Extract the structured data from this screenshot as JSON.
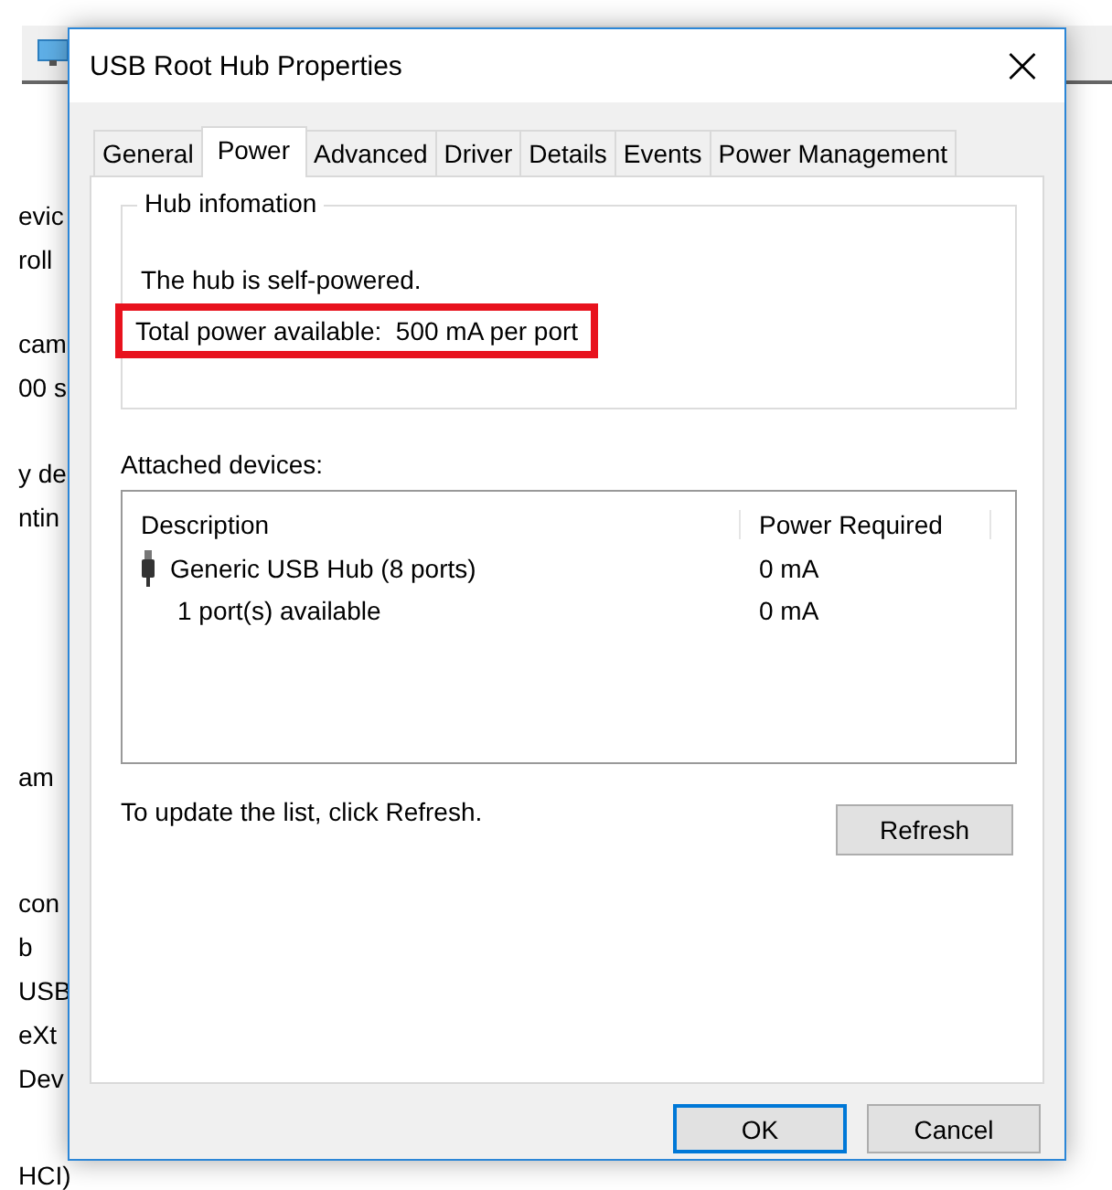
{
  "background_window": {
    "line_groups": [
      [
        "evic",
        "roll"
      ],
      [
        "cam",
        "00 s"
      ],
      [
        "y de",
        "ntin"
      ],
      [
        "am"
      ],
      [
        "con",
        "b",
        "USB",
        "eXt",
        "Dev"
      ],
      [
        "HCI)"
      ]
    ]
  },
  "dialog": {
    "title": "USB Root Hub Properties",
    "close": "×",
    "tabs": [
      {
        "label": "General",
        "selected": false
      },
      {
        "label": "Power",
        "selected": true
      },
      {
        "label": "Advanced",
        "selected": false
      },
      {
        "label": "Driver",
        "selected": false
      },
      {
        "label": "Details",
        "selected": false
      },
      {
        "label": "Events",
        "selected": false
      },
      {
        "label": "Power Management",
        "selected": false
      }
    ],
    "hub_information": {
      "legend": "Hub infomation",
      "status": "The hub is self-powered.",
      "total_power": "Total power available:  500 mA per port",
      "total_power_highlighted": true
    },
    "attached_devices": {
      "label": "Attached devices:",
      "columns": [
        "Description",
        "Power Required"
      ],
      "rows": [
        {
          "kind": "device",
          "description": "Generic USB Hub (8 ports)",
          "power": "0 mA"
        },
        {
          "kind": "info",
          "description": "1 port(s) available",
          "power": "0 mA"
        }
      ]
    },
    "hint": "To update the list, click Refresh.",
    "refresh_button": "Refresh",
    "buttons": [
      {
        "label": "OK",
        "default": true
      },
      {
        "label": "Cancel",
        "default": false
      }
    ]
  }
}
